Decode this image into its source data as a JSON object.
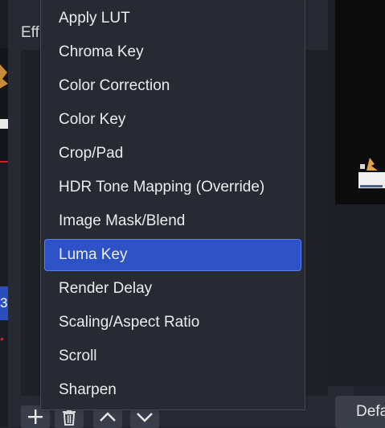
{
  "effects_label": "Eff",
  "menu": {
    "items": [
      {
        "label": "Apply LUT"
      },
      {
        "label": "Chroma Key"
      },
      {
        "label": "Color Correction"
      },
      {
        "label": "Color Key"
      },
      {
        "label": "Crop/Pad"
      },
      {
        "label": "HDR Tone Mapping (Override)"
      },
      {
        "label": "Image Mask/Blend"
      },
      {
        "label": "Luma Key",
        "selected": true
      },
      {
        "label": "Render Delay"
      },
      {
        "label": "Scaling/Aspect Ratio"
      },
      {
        "label": "Scroll"
      },
      {
        "label": "Sharpen"
      }
    ]
  },
  "toolbar": {
    "add_icon": "plus-icon",
    "remove_icon": "trash-icon",
    "move_up_icon": "chevron-up-icon",
    "move_down_icon": "chevron-down-icon"
  },
  "defaults_button": "Defa",
  "left_partial_text": "3",
  "colors": {
    "menu_background": "#272a33",
    "selected_item": "#2c52c5",
    "text": "#ececec"
  }
}
